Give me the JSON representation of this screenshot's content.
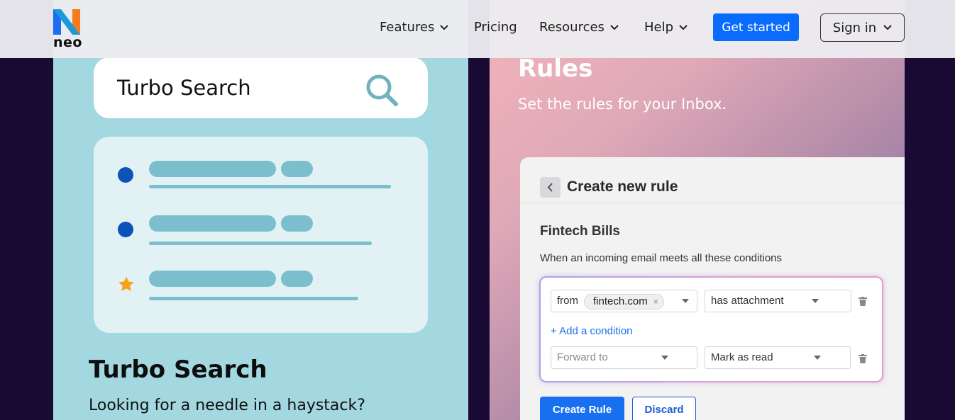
{
  "nav": {
    "logo_text": "neo",
    "items": [
      {
        "label": "Features"
      },
      {
        "label": "Pricing"
      },
      {
        "label": "Resources"
      },
      {
        "label": "Help"
      }
    ],
    "get_started_label": "Get started",
    "sign_in_label": "Sign in"
  },
  "left_card": {
    "search_bar_label": "Turbo Search",
    "heading": "Turbo Search",
    "description": "Looking for a needle in a haystack?",
    "list_markers": [
      "dot-icon",
      "dot-icon",
      "star-icon"
    ]
  },
  "right_card": {
    "heading": "Rules",
    "subheading": "Set the rules for your Inbox.",
    "panel": {
      "title": "Create new rule",
      "rule_name": "Fintech Bills",
      "description": "When an incoming email meets all these conditions",
      "condition": {
        "field_prefix": "from",
        "chip_value": "fintech.com",
        "chip_remove": "×",
        "operator": "has attachment"
      },
      "add_condition_label": "+ Add a condition",
      "action": {
        "placeholder": "Forward to",
        "value": "Mark as read"
      },
      "create_label": "Create Rule",
      "discard_label": "Discard"
    }
  },
  "colors": {
    "brand_blue": "#0a6cff",
    "background": "#190a33",
    "left_card_bg": "#a3d8e0",
    "bullet_blue": "#0b53b8",
    "star_orange": "#f7a21b"
  }
}
